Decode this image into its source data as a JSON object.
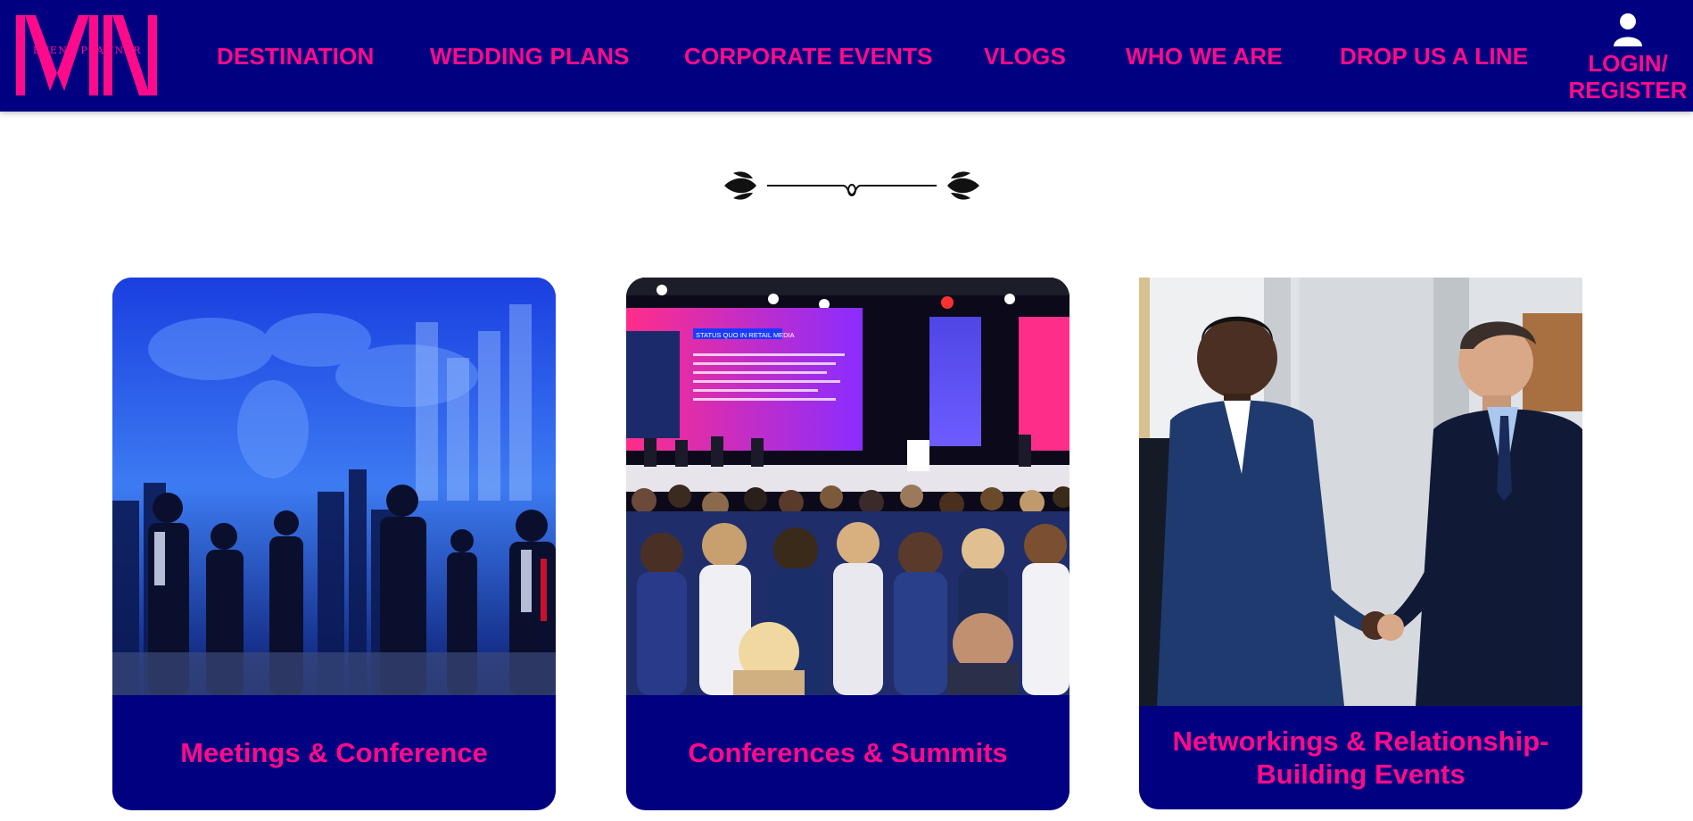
{
  "header": {
    "logo_text": "MN",
    "logo_subtext": "EVENT PLANNER",
    "nav": [
      {
        "label": "DESTINATION"
      },
      {
        "label": "WEDDING PLANS"
      },
      {
        "label": "CORPORATE EVENTS"
      },
      {
        "label": "VLOGS"
      },
      {
        "label": "WHO WE ARE"
      },
      {
        "label": "DROP US A LINE"
      }
    ],
    "login": {
      "line1": "LOGIN/",
      "line2": "REGISTER",
      "icon": "user-icon"
    }
  },
  "divider": {
    "icon": "ornamental-divider-icon"
  },
  "cards": [
    {
      "title": "Meetings & Conference",
      "image": "business-meeting-city-image"
    },
    {
      "title": "Conferences & Summits",
      "image": "conference-audience-stage-image",
      "screen_text": "STATUS QUO IN RETAIL MEDIA"
    },
    {
      "title": "Networkings & Relationship-Building Events",
      "image": "handshake-businessmen-image"
    }
  ],
  "colors": {
    "brand_navy": "#000080",
    "brand_pink": "#ff0a8a"
  }
}
